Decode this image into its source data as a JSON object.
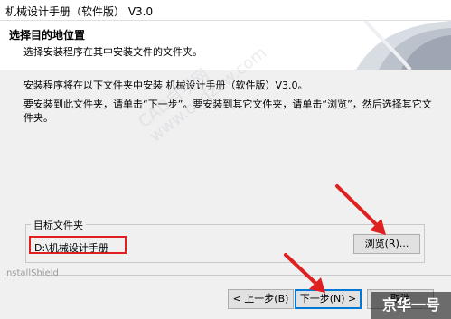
{
  "window": {
    "title": "机械设计手册（软件版） V3.0"
  },
  "header": {
    "title": "选择目的地位置",
    "subtitle": "选择安装程序在其中安装文件的文件夹。"
  },
  "body": {
    "line1": "安装程序将在以下文件夹中安装 机械设计手册（软件版）V3.0。",
    "line2": "要安装到此文件夹，请单击“下一步”。要安装到其它文件夹，请单击“浏览”，然后选择其它文件夹。"
  },
  "watermark": {
    "line1": "CAD自学网",
    "line2": "www.cadzxw.com"
  },
  "destination": {
    "group_label": "目标文件夹",
    "path": "D:\\机械设计手册",
    "browse_label": "浏览(R)..."
  },
  "footer": {
    "installshield_label": "InstallShield",
    "back_label": "< 上一步(B)",
    "next_label": "下一步(N) >",
    "cancel_label": "取消"
  },
  "overlay": {
    "brand_logo_text": "京华一号"
  },
  "colors": {
    "highlight": "#e02020",
    "focus": "#0078d7"
  }
}
